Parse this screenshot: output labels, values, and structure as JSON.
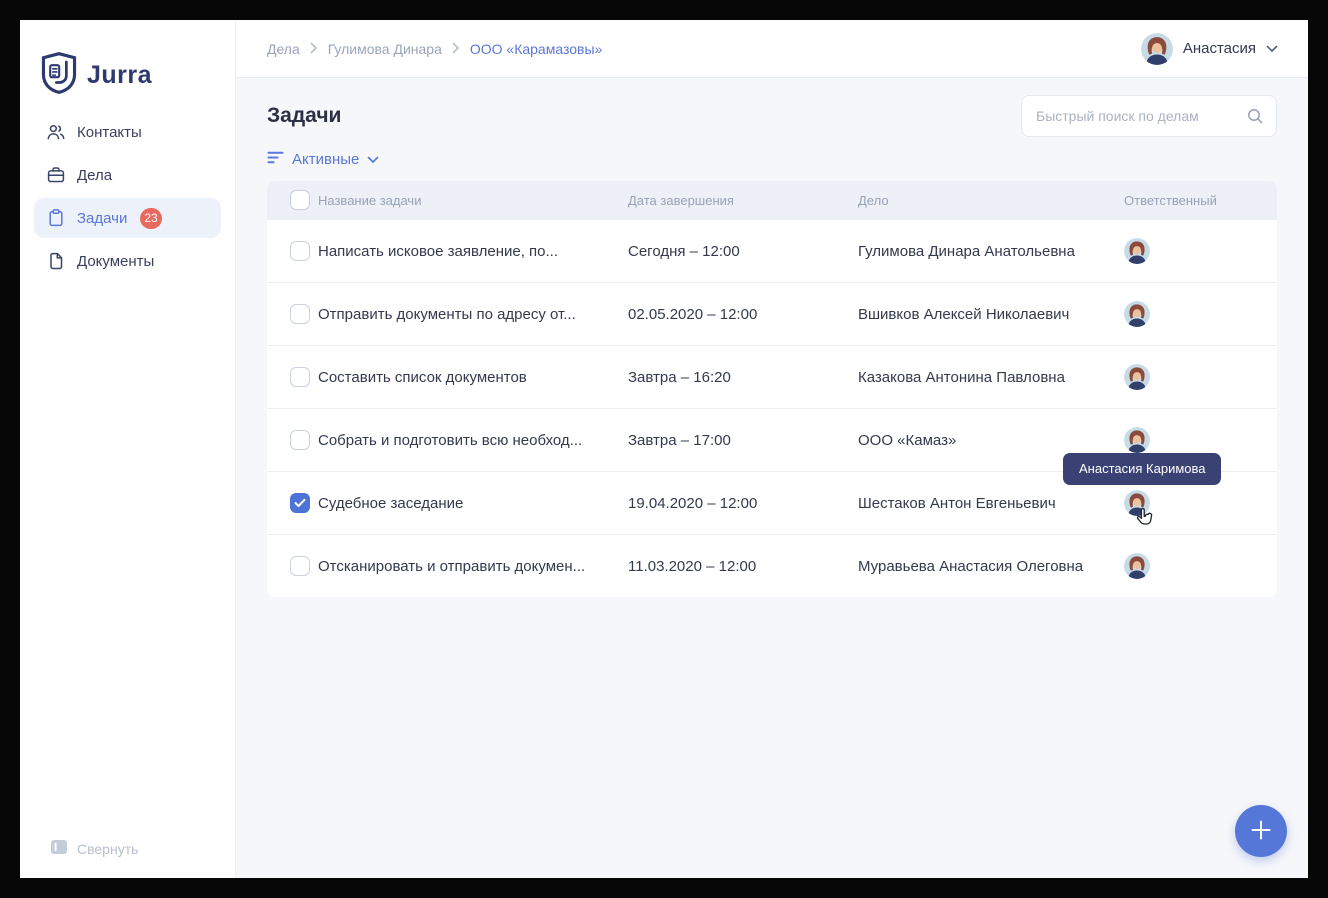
{
  "app": {
    "brand": "Jurra"
  },
  "colors": {
    "accent": "#5b77d7",
    "badge": "#e8695e",
    "tooltip_bg": "#3a4273",
    "fab": "#5577d8",
    "sidebar_active_bg": "#edf1fa"
  },
  "icons": {
    "logo": "jurra-shield-logo",
    "sidebar": [
      "contacts-icon",
      "briefcase-icon",
      "tasks-icon",
      "documents-icon"
    ],
    "search": "search-icon",
    "filter": "filter-icon",
    "chevron": "chevron-down-icon",
    "collapse": "collapse-sidebar-icon",
    "fab": "plus-icon",
    "cursor": "hand-cursor-icon",
    "avatar": "woman-avatar"
  },
  "sidebar": {
    "items": [
      {
        "label": "Контакты"
      },
      {
        "label": "Дела"
      },
      {
        "label": "Задачи",
        "badge": "23",
        "active": true
      },
      {
        "label": "Документы"
      }
    ],
    "collapse_label": "Свернуть"
  },
  "topbar": {
    "breadcrumbs": [
      {
        "label": "Дела"
      },
      {
        "label": "Гулимова Динара"
      },
      {
        "label": "ООО «Карамазовы»",
        "current": true
      }
    ],
    "user": {
      "name": "Анастасия"
    }
  },
  "page": {
    "title": "Задачи",
    "search_placeholder": "Быстрый поиск по делам",
    "filter_label": "Активные"
  },
  "table": {
    "headers": [
      "Название задачи",
      "Дата завершения",
      "Дело",
      "Ответственный"
    ],
    "rows": [
      {
        "name": "Написать исковое заявление, по...",
        "date": "Сегодня – 12:00",
        "case": "Гулимова Динара Анатольевна",
        "checked": false
      },
      {
        "name": "Отправить документы по адресу от...",
        "date": "02.05.2020 – 12:00",
        "case": "Вшивков Алексей Николаевич",
        "checked": false
      },
      {
        "name": "Составить список документов",
        "date": "Завтра – 16:20",
        "case": "Казакова Антонина Павловна",
        "checked": false
      },
      {
        "name": "Собрать и подготовить всю необход...",
        "date": "Завтра – 17:00",
        "case": "ООО «Камаз»",
        "checked": false
      },
      {
        "name": "Судебное заседание",
        "date": "19.04.2020 – 12:00",
        "case": "Шестаков Антон Евгеньевич",
        "checked": true
      },
      {
        "name": "Отсканировать и отправить докумен...",
        "date": "11.03.2020 – 12:00",
        "case": "Муравьева Анастасия Олеговна",
        "checked": false
      }
    ]
  },
  "tooltip": {
    "text": "Анастасия Каримова"
  }
}
